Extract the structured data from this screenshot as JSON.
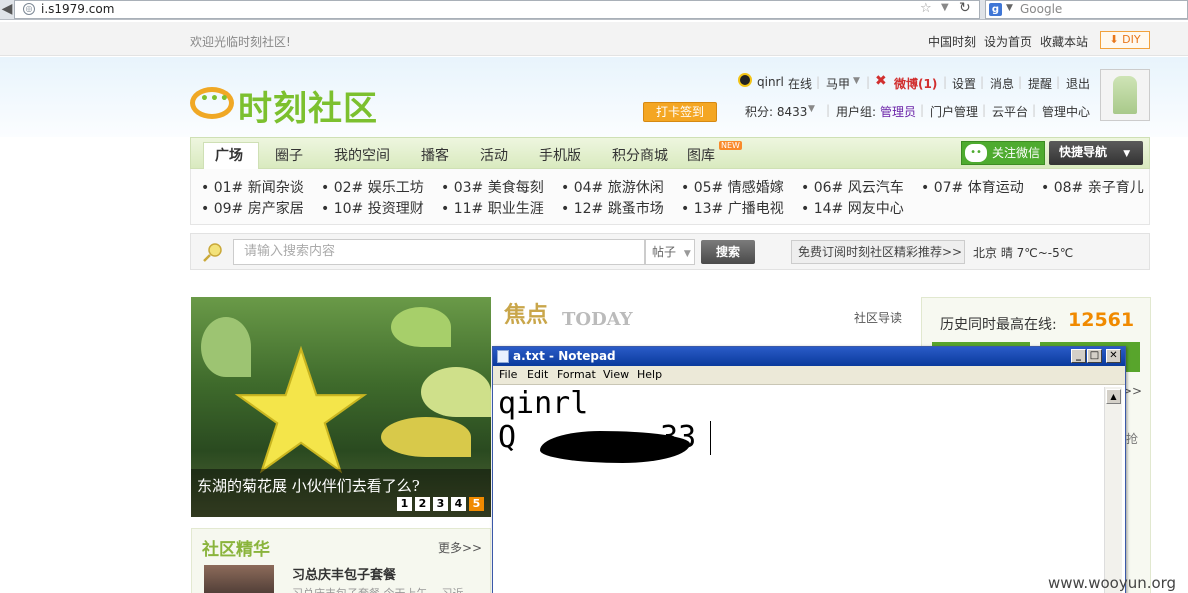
{
  "browser": {
    "url": "i.s1979.com",
    "search_engine_label": "g",
    "search_placeholder": "Google"
  },
  "topbar": {
    "welcome": "欢迎光临时刻社区!",
    "links": [
      "中国时刻",
      "设为首页",
      "收藏本站"
    ],
    "diy": "DIY"
  },
  "header": {
    "logo_text": "时刻社区",
    "username": "qinrl",
    "online": "在线",
    "horse": "马甲",
    "weibo": "微博(1)",
    "links": [
      "设置",
      "消息",
      "提醒",
      "退出"
    ],
    "checkin": "打卡签到",
    "points_label": "积分: 8433",
    "group_label": "用户组:",
    "group_value": "管理员",
    "links2": [
      "门户管理",
      "云平台",
      "管理中心"
    ]
  },
  "nav": {
    "tabs": [
      "广场",
      "圈子",
      "我的空间",
      "播客",
      "活动",
      "手机版",
      "积分商城",
      "图库"
    ],
    "new_badge": "NEW",
    "wechat": "关注微信",
    "quicknav": "快捷导航"
  },
  "categories": [
    "01# 新闻杂谈",
    "02# 娱乐工坊",
    "03# 美食每刻",
    "04# 旅游休闲",
    "05# 情感婚嫁",
    "06# 风云汽车",
    "07# 体育运动",
    "08# 亲子育儿",
    "09# 房产家居",
    "10# 投资理财",
    "11# 职业生涯",
    "12# 跳蚤市场",
    "13# 广播电视",
    "14# 网友中心"
  ],
  "search": {
    "placeholder": "请输入搜索内容",
    "type": "帖子",
    "button": "搜索",
    "subscribe": "免费订阅时刻社区精彩推荐>>",
    "weather": "北京  晴  7℃~-5℃"
  },
  "banner": {
    "caption": "东湖的菊花展 小伙伴们去看了么?",
    "pages": [
      "1",
      "2",
      "3",
      "4",
      "5"
    ]
  },
  "focus": {
    "title": "焦点",
    "today": "TODAY",
    "guide": "社区导读"
  },
  "stats": {
    "label": "历史同时最高在线:",
    "value": "12561",
    "more": ">>",
    "qiang": "抢"
  },
  "essence": {
    "title": "社区精华",
    "more": "更多>>",
    "headline": "习总庆丰包子套餐",
    "sub": "习总庆丰包子套餐 今天上午... 习近"
  },
  "notepad": {
    "title": "a.txt - Notepad",
    "menu": [
      "File",
      "Edit",
      "Format",
      "View",
      "Help"
    ],
    "line1": "qinrl",
    "line2_start": "Q",
    "line2_end": "33"
  },
  "watermark": "www.wooyun.org"
}
